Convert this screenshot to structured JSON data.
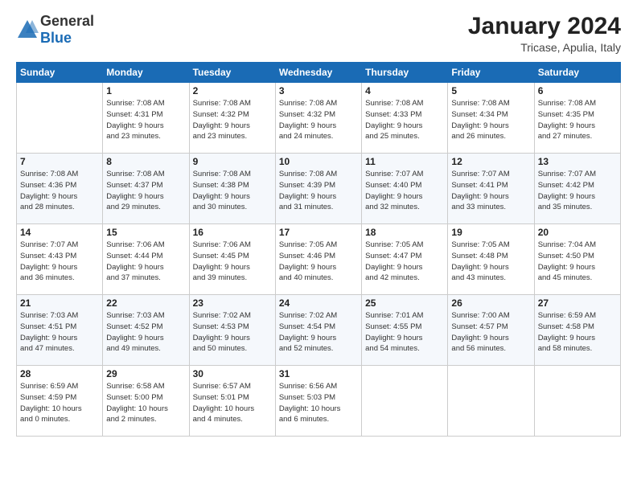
{
  "header": {
    "logo_general": "General",
    "logo_blue": "Blue",
    "title": "January 2024",
    "subtitle": "Tricase, Apulia, Italy"
  },
  "calendar": {
    "days_of_week": [
      "Sunday",
      "Monday",
      "Tuesday",
      "Wednesday",
      "Thursday",
      "Friday",
      "Saturday"
    ],
    "weeks": [
      [
        {
          "day": "",
          "detail": ""
        },
        {
          "day": "1",
          "detail": "Sunrise: 7:08 AM\nSunset: 4:31 PM\nDaylight: 9 hours\nand 23 minutes."
        },
        {
          "day": "2",
          "detail": "Sunrise: 7:08 AM\nSunset: 4:32 PM\nDaylight: 9 hours\nand 23 minutes."
        },
        {
          "day": "3",
          "detail": "Sunrise: 7:08 AM\nSunset: 4:32 PM\nDaylight: 9 hours\nand 24 minutes."
        },
        {
          "day": "4",
          "detail": "Sunrise: 7:08 AM\nSunset: 4:33 PM\nDaylight: 9 hours\nand 25 minutes."
        },
        {
          "day": "5",
          "detail": "Sunrise: 7:08 AM\nSunset: 4:34 PM\nDaylight: 9 hours\nand 26 minutes."
        },
        {
          "day": "6",
          "detail": "Sunrise: 7:08 AM\nSunset: 4:35 PM\nDaylight: 9 hours\nand 27 minutes."
        }
      ],
      [
        {
          "day": "7",
          "detail": "Sunrise: 7:08 AM\nSunset: 4:36 PM\nDaylight: 9 hours\nand 28 minutes."
        },
        {
          "day": "8",
          "detail": "Sunrise: 7:08 AM\nSunset: 4:37 PM\nDaylight: 9 hours\nand 29 minutes."
        },
        {
          "day": "9",
          "detail": "Sunrise: 7:08 AM\nSunset: 4:38 PM\nDaylight: 9 hours\nand 30 minutes."
        },
        {
          "day": "10",
          "detail": "Sunrise: 7:08 AM\nSunset: 4:39 PM\nDaylight: 9 hours\nand 31 minutes."
        },
        {
          "day": "11",
          "detail": "Sunrise: 7:07 AM\nSunset: 4:40 PM\nDaylight: 9 hours\nand 32 minutes."
        },
        {
          "day": "12",
          "detail": "Sunrise: 7:07 AM\nSunset: 4:41 PM\nDaylight: 9 hours\nand 33 minutes."
        },
        {
          "day": "13",
          "detail": "Sunrise: 7:07 AM\nSunset: 4:42 PM\nDaylight: 9 hours\nand 35 minutes."
        }
      ],
      [
        {
          "day": "14",
          "detail": "Sunrise: 7:07 AM\nSunset: 4:43 PM\nDaylight: 9 hours\nand 36 minutes."
        },
        {
          "day": "15",
          "detail": "Sunrise: 7:06 AM\nSunset: 4:44 PM\nDaylight: 9 hours\nand 37 minutes."
        },
        {
          "day": "16",
          "detail": "Sunrise: 7:06 AM\nSunset: 4:45 PM\nDaylight: 9 hours\nand 39 minutes."
        },
        {
          "day": "17",
          "detail": "Sunrise: 7:05 AM\nSunset: 4:46 PM\nDaylight: 9 hours\nand 40 minutes."
        },
        {
          "day": "18",
          "detail": "Sunrise: 7:05 AM\nSunset: 4:47 PM\nDaylight: 9 hours\nand 42 minutes."
        },
        {
          "day": "19",
          "detail": "Sunrise: 7:05 AM\nSunset: 4:48 PM\nDaylight: 9 hours\nand 43 minutes."
        },
        {
          "day": "20",
          "detail": "Sunrise: 7:04 AM\nSunset: 4:50 PM\nDaylight: 9 hours\nand 45 minutes."
        }
      ],
      [
        {
          "day": "21",
          "detail": "Sunrise: 7:03 AM\nSunset: 4:51 PM\nDaylight: 9 hours\nand 47 minutes."
        },
        {
          "day": "22",
          "detail": "Sunrise: 7:03 AM\nSunset: 4:52 PM\nDaylight: 9 hours\nand 49 minutes."
        },
        {
          "day": "23",
          "detail": "Sunrise: 7:02 AM\nSunset: 4:53 PM\nDaylight: 9 hours\nand 50 minutes."
        },
        {
          "day": "24",
          "detail": "Sunrise: 7:02 AM\nSunset: 4:54 PM\nDaylight: 9 hours\nand 52 minutes."
        },
        {
          "day": "25",
          "detail": "Sunrise: 7:01 AM\nSunset: 4:55 PM\nDaylight: 9 hours\nand 54 minutes."
        },
        {
          "day": "26",
          "detail": "Sunrise: 7:00 AM\nSunset: 4:57 PM\nDaylight: 9 hours\nand 56 minutes."
        },
        {
          "day": "27",
          "detail": "Sunrise: 6:59 AM\nSunset: 4:58 PM\nDaylight: 9 hours\nand 58 minutes."
        }
      ],
      [
        {
          "day": "28",
          "detail": "Sunrise: 6:59 AM\nSunset: 4:59 PM\nDaylight: 10 hours\nand 0 minutes."
        },
        {
          "day": "29",
          "detail": "Sunrise: 6:58 AM\nSunset: 5:00 PM\nDaylight: 10 hours\nand 2 minutes."
        },
        {
          "day": "30",
          "detail": "Sunrise: 6:57 AM\nSunset: 5:01 PM\nDaylight: 10 hours\nand 4 minutes."
        },
        {
          "day": "31",
          "detail": "Sunrise: 6:56 AM\nSunset: 5:03 PM\nDaylight: 10 hours\nand 6 minutes."
        },
        {
          "day": "",
          "detail": ""
        },
        {
          "day": "",
          "detail": ""
        },
        {
          "day": "",
          "detail": ""
        }
      ]
    ]
  }
}
